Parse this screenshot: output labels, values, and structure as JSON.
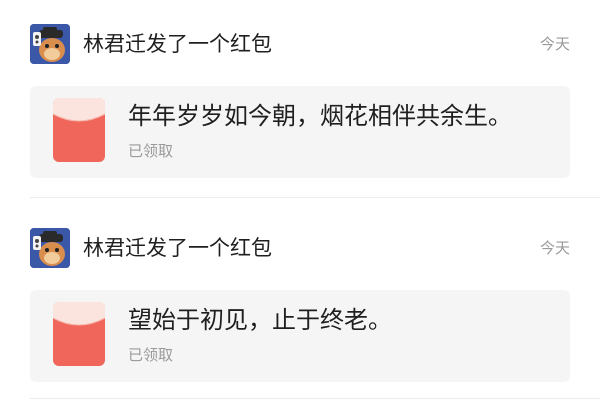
{
  "feed": {
    "entries": [
      {
        "sender_line": "林君迁发了一个红包",
        "time": "今天",
        "message": "年年岁岁如今朝，烟花相伴共余生。",
        "status": "已领取"
      },
      {
        "sender_line": "林君迁发了一个红包",
        "time": "今天",
        "message": "望始于初见，止于终老。",
        "status": "已领取"
      }
    ]
  },
  "colors": {
    "card_background": "#f5f5f5",
    "red_packet": "#f0665a",
    "red_packet_flap": "#fbe4de",
    "secondary_text": "#9a9a9a",
    "avatar_background": "#3a57a8"
  },
  "icons": {
    "avatar": "cartoon-avatar-icon",
    "red_packet": "red-packet-icon"
  }
}
